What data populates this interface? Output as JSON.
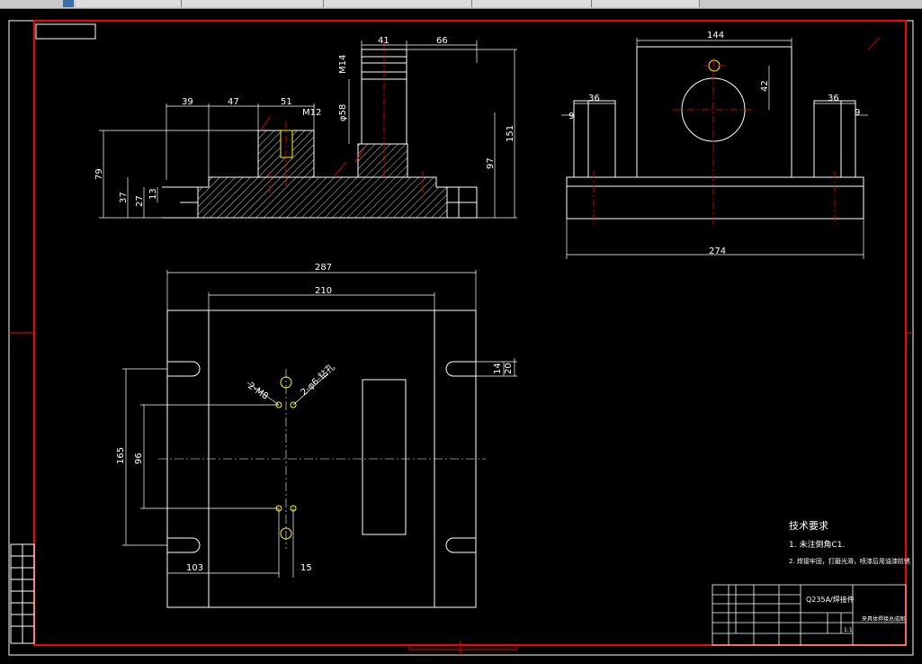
{
  "tabs": [
    {
      "label": ""
    },
    {
      "label": ""
    },
    {
      "label": ""
    },
    {
      "label": ""
    },
    {
      "label": ""
    }
  ],
  "drawing": {
    "colors": {
      "background": "#000000",
      "line": "#ffffff",
      "border": "#ff0000",
      "dimension": "#ffffff",
      "center": "#ff0000",
      "highlight": "#ffff00"
    },
    "front_view": {
      "dims": {
        "d39": "39",
        "d47": "47",
        "d51": "51",
        "m12": "M12",
        "d41": "41",
        "d66": "66",
        "m14": "M14",
        "d58": "φ58",
        "d151": "151",
        "d97": "97",
        "d79": "79",
        "d37": "37",
        "d27": "27",
        "d13": "13"
      }
    },
    "side_view": {
      "dims": {
        "d144": "144",
        "d42": "42",
        "d36a": "36",
        "d36b": "36",
        "d9a": "9",
        "d9b": "9",
        "d274": "274"
      }
    },
    "plan_view": {
      "dims": {
        "d287": "287",
        "d210": "210",
        "d165": "165",
        "d96": "96",
        "d103": "103",
        "d15": "15",
        "d14": "14",
        "d20": "20",
        "m8": "2-M8",
        "d6": "2-φ6-钻孔"
      }
    },
    "notes": {
      "title": "技术要求",
      "item1": "1. 未注倒角C1.",
      "item2": "2. 焊接牢固，打磨光滑，喷漆后用油漆防锈"
    },
    "titleblock": {
      "material": "Q235A/焊接件",
      "name": "夹具体焊接总成图",
      "scale": "1:1"
    }
  }
}
